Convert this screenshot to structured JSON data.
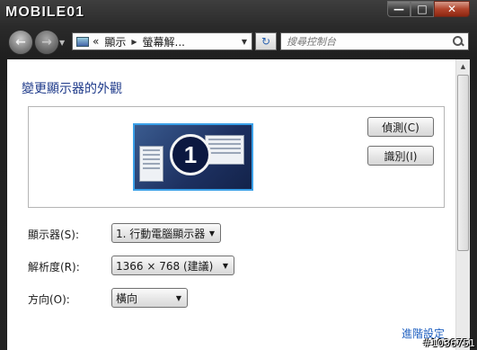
{
  "titlebar": {
    "logo_text": "MOBILE01",
    "buttons": {
      "minimize": "—",
      "maximize": "□",
      "close": "✕"
    }
  },
  "navbar": {
    "back_icon": "←",
    "forward_icon": "→",
    "address": {
      "prefix": "«",
      "segments": [
        "顯示",
        "螢幕解..."
      ]
    },
    "refresh_icon": "↻",
    "search_placeholder": "搜尋控制台"
  },
  "main": {
    "title": "變更顯示器的外觀",
    "monitor_number": "1",
    "detect_button": "偵測(C)",
    "identify_button": "識別(I)",
    "settings": {
      "display": {
        "label": "顯示器(S):",
        "value": "1. 行動電腦顯示器"
      },
      "resolution": {
        "label": "解析度(R):",
        "value": "1366 × 768 (建議)"
      },
      "orientation": {
        "label": "方向(O):",
        "value": "橫向"
      }
    },
    "advanced_link": "進階設定"
  },
  "watermark": "#1036751"
}
